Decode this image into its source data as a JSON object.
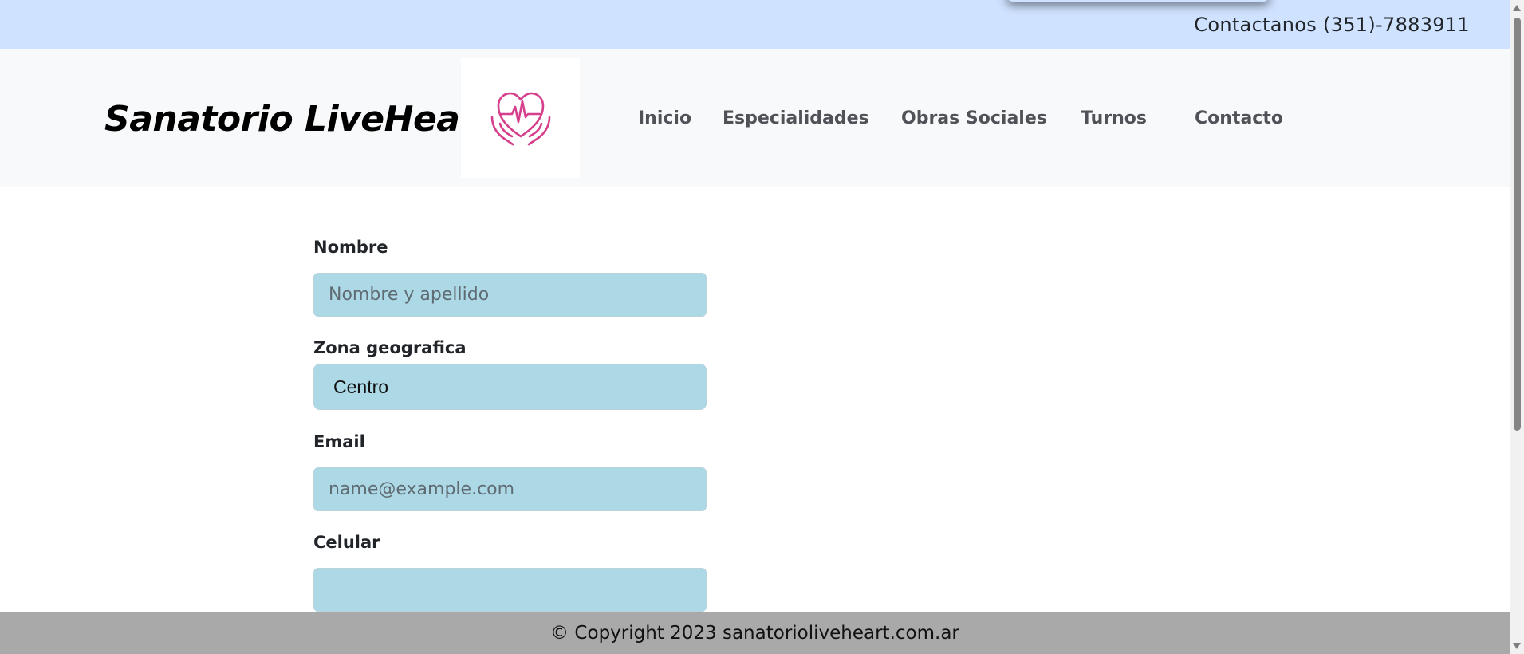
{
  "topbar": {
    "contact": "Contactanos (351)-7883911"
  },
  "navbar": {
    "brand": "Sanatorio LiveHeart",
    "links": [
      "Inicio",
      "Especialidades",
      "Obras Sociales",
      "Turnos",
      "Contacto"
    ]
  },
  "form": {
    "nombre_label": "Nombre",
    "nombre_placeholder": "Nombre y apellido",
    "zona_label": "Zona geografica",
    "zona_value": "Centro",
    "email_label": "Email",
    "email_placeholder": "name@example.com",
    "celular_label": "Celular",
    "celular_value": ""
  },
  "footer": {
    "text": "© Copyright 2023 sanatorioliveheart.com.ar"
  },
  "colors": {
    "topbar": "#cfe2ff",
    "navbar": "#f8f9fa",
    "input_bg": "#add8e6",
    "footer": "#a9a9a9",
    "logo_accent": "#d63f8c"
  },
  "icons": {
    "logo": "heart-hands-logo-icon"
  }
}
